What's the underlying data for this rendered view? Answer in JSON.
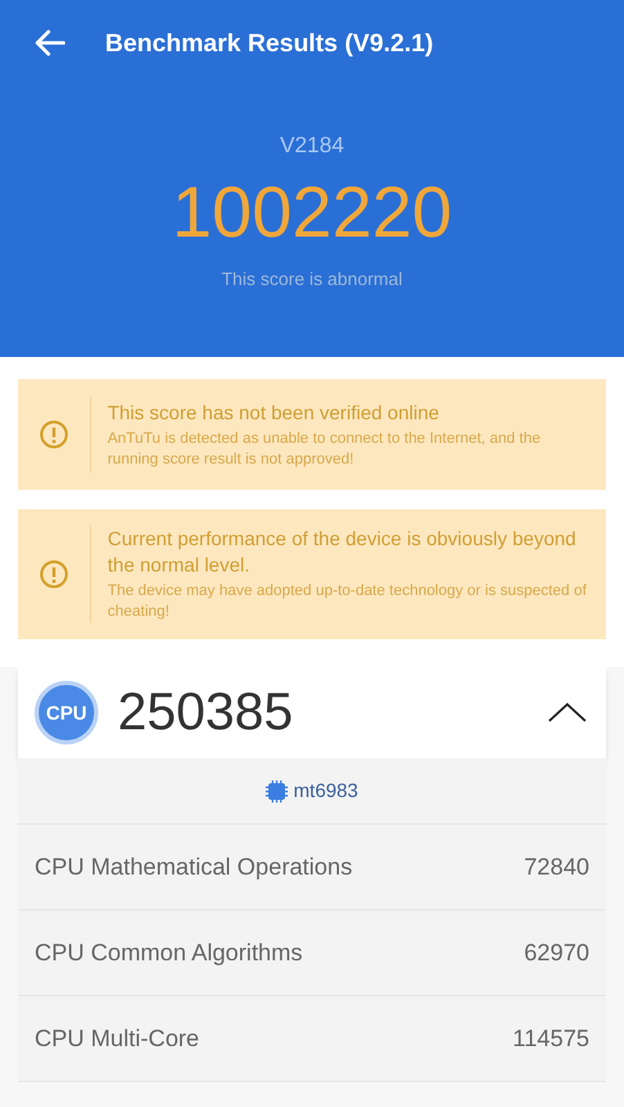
{
  "header": {
    "title": "Benchmark Results (V9.2.1)",
    "device": "V2184",
    "total_score": "1002220",
    "score_note": "This score is abnormal"
  },
  "warnings": [
    {
      "title": "This score has not been verified online",
      "detail": "AnTuTu is detected as unable to connect to the Internet, and the running score result is not approved!"
    },
    {
      "title": "Current performance of the device is obviously beyond the normal level.",
      "detail": "The device may have adopted up-to-date technology or is suspected of cheating!"
    }
  ],
  "section": {
    "badge": "CPU",
    "score": "250385",
    "expanded": true,
    "chip": "mt6983",
    "rows": [
      {
        "label": "CPU Mathematical Operations",
        "value": "72840"
      },
      {
        "label": "CPU Common Algorithms",
        "value": "62970"
      },
      {
        "label": "CPU Multi-Core",
        "value": "114575"
      }
    ]
  }
}
